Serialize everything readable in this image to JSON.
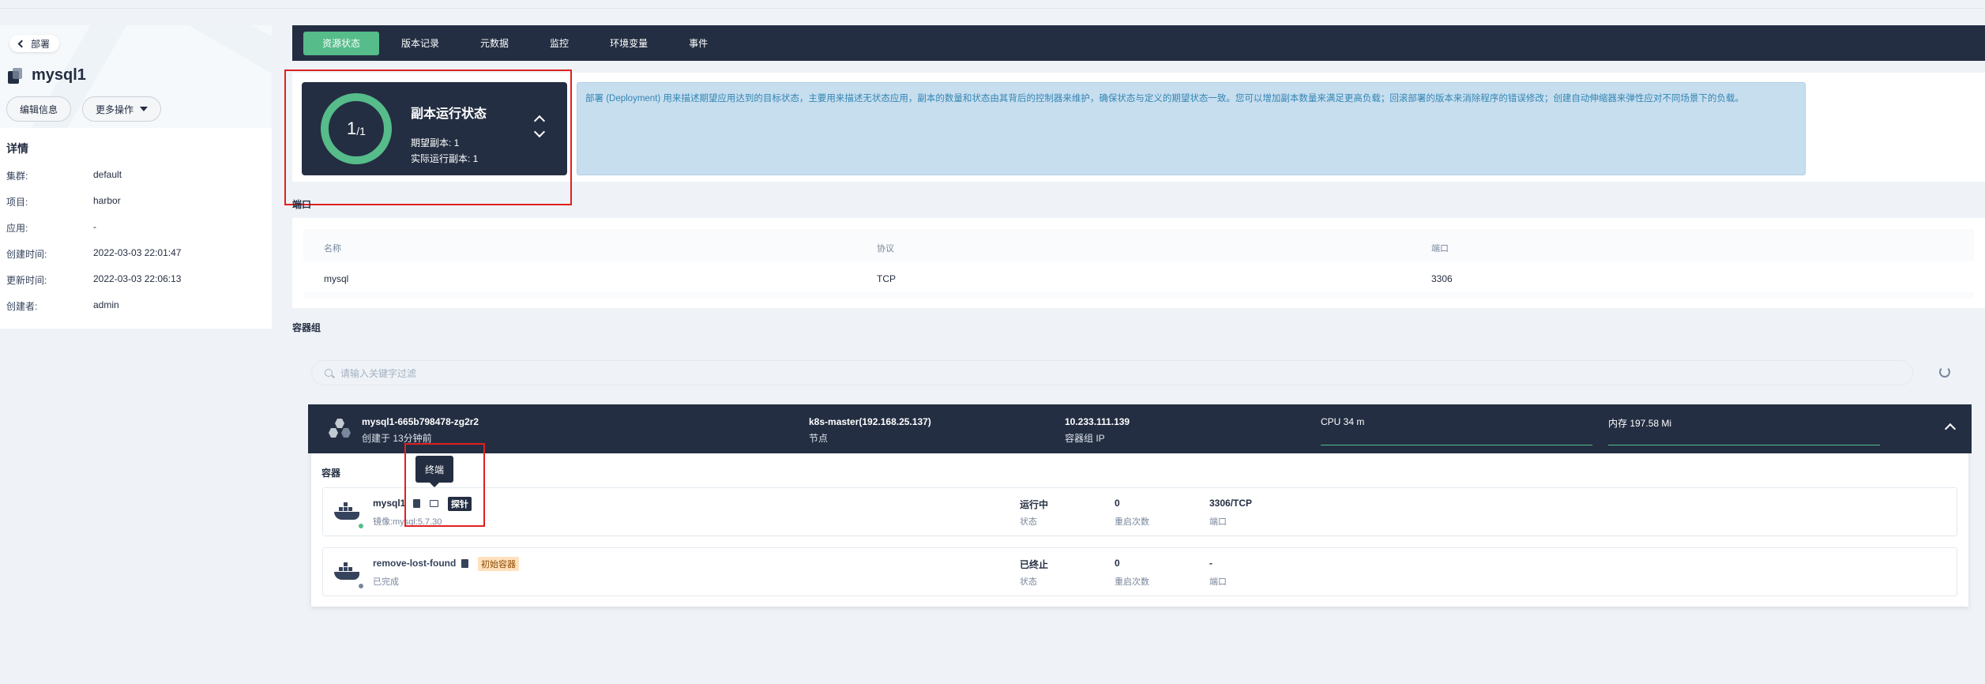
{
  "back": {
    "label": "部署"
  },
  "title": "mysql1",
  "actions": {
    "edit": "编辑信息",
    "more": "更多操作"
  },
  "details": {
    "heading": "详情",
    "rows": [
      {
        "key": "集群:",
        "value": "default"
      },
      {
        "key": "项目:",
        "value": "harbor"
      },
      {
        "key": "应用:",
        "value": "-"
      },
      {
        "key": "创建时间:",
        "value": "2022-03-03 22:01:47"
      },
      {
        "key": "更新时间:",
        "value": "2022-03-03 22:06:13"
      },
      {
        "key": "创建者:",
        "value": "admin"
      }
    ]
  },
  "tabs": [
    {
      "label": "资源状态",
      "active": true
    },
    {
      "label": "版本记录"
    },
    {
      "label": "元数据"
    },
    {
      "label": "监控"
    },
    {
      "label": "环境变量"
    },
    {
      "label": "事件"
    }
  ],
  "replica": {
    "current": "1",
    "total": "/1",
    "title": "副本运行状态",
    "desired": "期望副本: 1",
    "actual": "实际运行副本: 1"
  },
  "info_text": "部署 (Deployment) 用来描述期望应用达到的目标状态，主要用来描述无状态应用，副本的数量和状态由其背后的控制器来维护，确保状态与定义的期望状态一致。您可以增加副本数量来满足更高负载；回滚部署的版本来消除程序的错误修改；创建自动伸缩器来弹性应对不同场景下的负载。",
  "ports": {
    "section": "端口",
    "headers": [
      "名称",
      "协议",
      "端口"
    ],
    "rows": [
      [
        "mysql",
        "TCP",
        "3306"
      ]
    ]
  },
  "pods": {
    "section": "容器组",
    "search_placeholder": "请输入关键字过滤",
    "pod": {
      "name": "mysql1-665b798478-zg2r2",
      "created": "创建于 13分钟前",
      "node": "k8s-master(192.168.25.137)",
      "node_label": "节点",
      "ip": "10.233.111.139",
      "ip_label": "容器组 IP",
      "cpu": "CPU 34 m",
      "memory": "内存 197.58 Mi"
    },
    "containers_label": "容器",
    "tooltip": "终端",
    "containers": [
      {
        "name": "mysql1",
        "tag": "探针",
        "image": "镜像:mysql:5.7.30",
        "status": "运行中",
        "status_label": "状态",
        "restarts": "0",
        "restarts_label": "重启次数",
        "port": "3306/TCP",
        "port_label": "端口",
        "dot_color": "#55bc8a"
      },
      {
        "name": "remove-lost-found",
        "tag": "初始容器",
        "image": "已完成",
        "status": "已终止",
        "status_label": "状态",
        "restarts": "0",
        "restarts_label": "重启次数",
        "port": "-",
        "port_label": "端口",
        "dot_color": "#79879c"
      }
    ]
  },
  "colors": {
    "accent": "#55bc8a",
    "dark": "#242e42",
    "info_bg": "#c7deef",
    "highlight": "#e02020"
  }
}
